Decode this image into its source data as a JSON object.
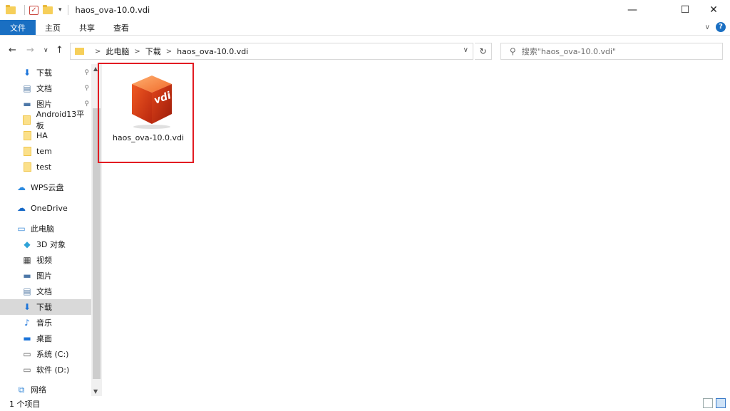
{
  "window": {
    "title": "haos_ova-10.0.vdi",
    "minimize": "—",
    "maximize": "☐",
    "close": "✕"
  },
  "ribbon": {
    "tabs": [
      "文件",
      "主页",
      "共享",
      "查看"
    ],
    "collapse": "∨",
    "help": "?"
  },
  "address": {
    "segments": [
      "此电脑",
      "下载",
      "haos_ova-10.0.vdi"
    ],
    "search_placeholder": "搜索\"haos_ova-10.0.vdi\""
  },
  "sidebar": {
    "quick_access": [
      {
        "label": "下载",
        "icon": "download-arrow-icon",
        "pinned": true
      },
      {
        "label": "文档",
        "icon": "document-icon",
        "pinned": true
      },
      {
        "label": "图片",
        "icon": "picture-icon",
        "pinned": true
      },
      {
        "label": "Android13平板",
        "icon": "folder-icon",
        "pinned": false
      },
      {
        "label": "HA",
        "icon": "folder-icon",
        "pinned": false
      },
      {
        "label": "tem",
        "icon": "folder-icon",
        "pinned": false
      },
      {
        "label": "test",
        "icon": "folder-icon",
        "pinned": false
      }
    ],
    "wps": "WPS云盘",
    "onedrive": "OneDrive",
    "this_pc": "此电脑",
    "pc_items": [
      {
        "label": "3D 对象",
        "icon": "3d-objects-icon"
      },
      {
        "label": "视频",
        "icon": "video-icon"
      },
      {
        "label": "图片",
        "icon": "picture-icon"
      },
      {
        "label": "文档",
        "icon": "document-icon"
      },
      {
        "label": "下载",
        "icon": "download-arrow-icon",
        "selected": true
      },
      {
        "label": "音乐",
        "icon": "music-icon"
      },
      {
        "label": "桌面",
        "icon": "desktop-icon"
      },
      {
        "label": "系统 (C:)",
        "icon": "drive-icon"
      },
      {
        "label": "软件 (D:)",
        "icon": "drive-icon"
      }
    ],
    "network": "网络"
  },
  "content": {
    "file": {
      "name": "haos_ova-10.0.vdi",
      "icon_text": "vdi",
      "icon": "vdi-file-icon"
    }
  },
  "status": {
    "count": "1 个项目"
  },
  "colors": {
    "accent": "#1a6fc2",
    "highlight": "#e21b22"
  }
}
